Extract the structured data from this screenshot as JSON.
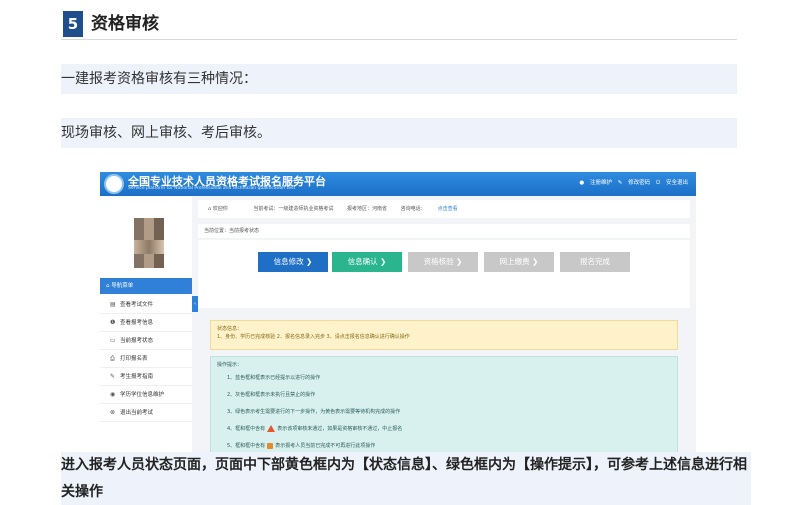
{
  "section": {
    "number": "5",
    "title": "资格审核"
  },
  "paragraphs": [
    "一建报考资格审核有三种情况：",
    "现场审核、网上审核、考后审核。"
  ],
  "screenshot": {
    "title": "全国专业技术人员资格考试报名服务平台",
    "subtitle": "Service platform for National Professional and technician qualification test",
    "top_links": [
      "注册维护",
      "修改密码",
      "安全退出"
    ],
    "infobar": {
      "welcome": "欢迎你",
      "current_exam": "当前考试：一级建造师执业资格考试",
      "region": "报考地区：河南省",
      "phone_label": "咨询电话：",
      "phone_link": "点击查看"
    },
    "crumb": "当前位置：当前报考状态",
    "steps": [
      "信息修改",
      "信息确认",
      "资格核验",
      "网上缴费",
      "报名完成"
    ],
    "nav_head": "导航菜单",
    "nav_items": [
      {
        "icon": "file-icon",
        "glyph": "▤",
        "label": "查看考试文件"
      },
      {
        "icon": "info-icon",
        "glyph": "❶",
        "label": "查看报考信息"
      },
      {
        "icon": "monitor-icon",
        "glyph": "▭",
        "label": "当前报考状态"
      },
      {
        "icon": "printer-icon",
        "glyph": "⎙",
        "label": "打印报名表"
      },
      {
        "icon": "book-icon",
        "glyph": "✎",
        "label": "考生报考指南"
      },
      {
        "icon": "edu-icon",
        "glyph": "◉",
        "label": "学历学位信息维护"
      },
      {
        "icon": "exit-icon",
        "glyph": "⊗",
        "label": "退出当前考试"
      }
    ],
    "status_box": {
      "heading": "状态信息：",
      "text": "1、身份、学历已完成核验 2、报名信息录入完步 3、请点击报名信息确认进行确认操作"
    },
    "tips_box": {
      "heading": "操作提示：",
      "rows": [
        "1、蓝色框和框表示已经提示以进行的操作",
        "2、灰色框和框表示未执行且禁止的操作",
        "3、绿色表示考生需要进行的下一步操作，为黄色表示需要等待机构完成的操作",
        "4、框和框中含有",
        "5、框和框中含有"
      ],
      "row4_suffix": "表示该项审核未通过，如果是资格审核不通过，中止报名",
      "row5_suffix": "表示报考人员当前已完成不可再进行此项操作"
    }
  },
  "bottom_text": "进入报考人员状态页面，页面中下部黄色框内为【状态信息】、绿色框内为【操作提示】，可参考上述信息进行相关操作"
}
